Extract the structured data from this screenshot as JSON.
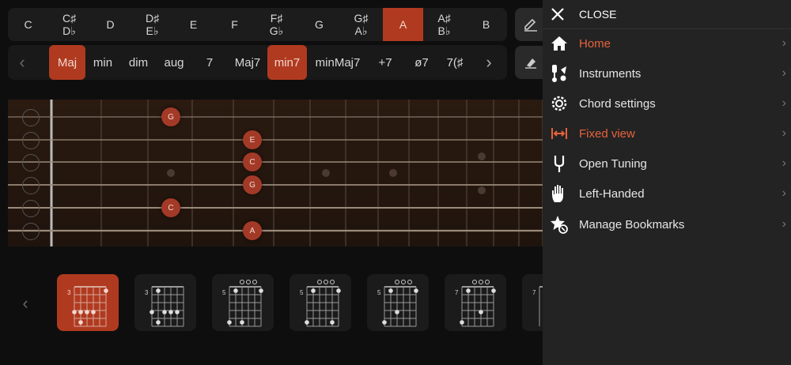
{
  "keys": [
    {
      "top": "C",
      "bottom": ""
    },
    {
      "top": "C♯",
      "bottom": "D♭"
    },
    {
      "top": "D",
      "bottom": ""
    },
    {
      "top": "D♯",
      "bottom": "E♭"
    },
    {
      "top": "E",
      "bottom": ""
    },
    {
      "top": "F",
      "bottom": ""
    },
    {
      "top": "F♯",
      "bottom": "G♭"
    },
    {
      "top": "G",
      "bottom": ""
    },
    {
      "top": "G♯",
      "bottom": "A♭"
    },
    {
      "top": "A",
      "bottom": ""
    },
    {
      "top": "A♯",
      "bottom": "B♭"
    },
    {
      "top": "B",
      "bottom": ""
    }
  ],
  "qualities": [
    "Maj",
    "min",
    "dim",
    "aug",
    "7",
    "Maj7",
    "min7",
    "minMaj7",
    "+7",
    "ø7",
    "7(♯"
  ],
  "fretboard": {
    "notes": [
      "G",
      "E",
      "C",
      "G",
      "C",
      "A"
    ]
  },
  "chord_frets": [
    "3",
    "3",
    "5",
    "5",
    "5",
    "7",
    "7"
  ],
  "drawer": {
    "close_label": "CLOSE",
    "items": [
      {
        "label": "Home",
        "icon": "home-icon"
      },
      {
        "label": "Instruments",
        "icon": "instruments-icon"
      },
      {
        "label": "Chord settings",
        "icon": "gear-icon"
      },
      {
        "label": "Fixed view",
        "icon": "fixed-view-icon"
      },
      {
        "label": "Open Tuning",
        "icon": "tuning-fork-icon"
      },
      {
        "label": "Left-Handed",
        "icon": "hand-icon"
      },
      {
        "label": "Manage Bookmarks",
        "icon": "bookmark-star-icon"
      }
    ]
  },
  "colors": {
    "accent": "#b03a20",
    "highlight": "#e8623c",
    "drawer_bg": "#232323"
  }
}
